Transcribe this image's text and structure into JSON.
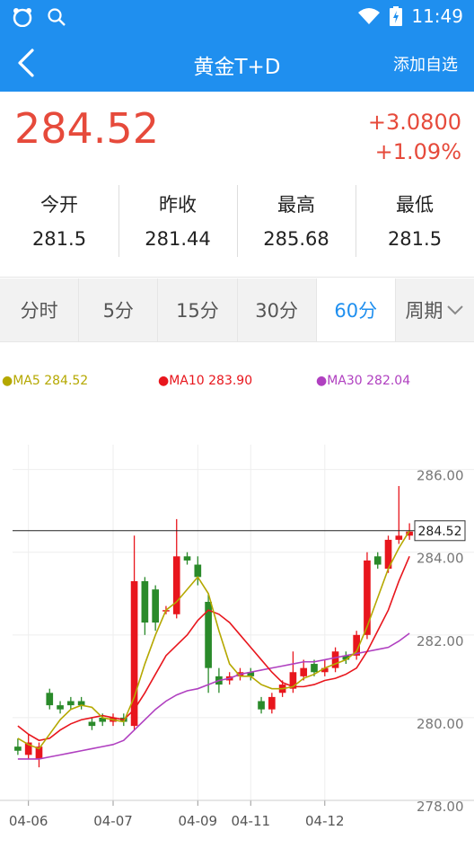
{
  "status": {
    "time": "11:49"
  },
  "header": {
    "title": "黄金T+D",
    "action": "添加自选"
  },
  "quote": {
    "price": "284.52",
    "change": "+3.0800",
    "change_pct": "+1.09%"
  },
  "stats": [
    {
      "label": "今开",
      "value": "281.5"
    },
    {
      "label": "昨收",
      "value": "281.44"
    },
    {
      "label": "最高",
      "value": "285.68"
    },
    {
      "label": "最低",
      "value": "281.5"
    }
  ],
  "tabs": [
    {
      "label": "分时"
    },
    {
      "label": "5分"
    },
    {
      "label": "15分"
    },
    {
      "label": "30分"
    },
    {
      "label": "60分"
    },
    {
      "label": "周期"
    }
  ],
  "colors": {
    "brand": "#1f8fef",
    "up": "#e8161d",
    "down": "#2a8a2a",
    "ma5": "#b5a800",
    "ma10": "#e8161d",
    "ma30": "#b040c0"
  },
  "chart_data": {
    "type": "candlestick",
    "legend": [
      {
        "name": "MA5",
        "value": "284.52"
      },
      {
        "name": "MA10",
        "value": "283.90"
      },
      {
        "name": "MA30",
        "value": "282.04"
      }
    ],
    "ylim": [
      278,
      286.6
    ],
    "yticks": [
      "286.00",
      "284.00",
      "282.00",
      "280.00",
      "278.00"
    ],
    "ytick_values": [
      286,
      284,
      282,
      280,
      278
    ],
    "last_price": 284.52,
    "last_price_label": "284.52",
    "xtick_labels": [
      "04-06",
      "04-07",
      "04-09",
      "04-11",
      "04-12"
    ],
    "xtick_index": [
      1,
      9,
      17,
      22,
      29
    ],
    "candles": [
      {
        "o": 279.3,
        "c": 279.2,
        "h": 279.5,
        "l": 279.1
      },
      {
        "o": 279.1,
        "c": 279.4,
        "h": 279.6,
        "l": 279.0
      },
      {
        "o": 279.0,
        "c": 279.3,
        "h": 279.4,
        "l": 278.8
      },
      {
        "o": 280.6,
        "c": 280.3,
        "h": 280.7,
        "l": 280.2
      },
      {
        "o": 280.3,
        "c": 280.2,
        "h": 280.4,
        "l": 280.1
      },
      {
        "o": 280.4,
        "c": 280.3,
        "h": 280.5,
        "l": 280.2
      },
      {
        "o": 280.4,
        "c": 280.3,
        "h": 280.5,
        "l": 280.2
      },
      {
        "o": 279.9,
        "c": 279.8,
        "h": 280.0,
        "l": 279.7
      },
      {
        "o": 280.0,
        "c": 279.9,
        "h": 280.1,
        "l": 279.8
      },
      {
        "o": 279.9,
        "c": 280.0,
        "h": 280.1,
        "l": 279.8
      },
      {
        "o": 280.0,
        "c": 279.9,
        "h": 280.1,
        "l": 279.8
      },
      {
        "o": 279.8,
        "c": 283.3,
        "h": 284.4,
        "l": 279.7
      },
      {
        "o": 283.3,
        "c": 282.3,
        "h": 283.4,
        "l": 282.0
      },
      {
        "o": 283.1,
        "c": 282.3,
        "h": 283.2,
        "l": 282.1
      },
      {
        "o": 282.6,
        "c": 282.6,
        "h": 282.7,
        "l": 282.5
      },
      {
        "o": 282.5,
        "c": 283.9,
        "h": 284.8,
        "l": 282.4
      },
      {
        "o": 283.9,
        "c": 283.8,
        "h": 284.0,
        "l": 283.7
      },
      {
        "o": 283.7,
        "c": 283.4,
        "h": 283.9,
        "l": 283.2
      },
      {
        "o": 282.8,
        "c": 281.2,
        "h": 283.0,
        "l": 280.6
      },
      {
        "o": 281.0,
        "c": 280.8,
        "h": 281.2,
        "l": 280.6
      },
      {
        "o": 280.9,
        "c": 281.0,
        "h": 281.1,
        "l": 280.8
      },
      {
        "o": 281.0,
        "c": 281.1,
        "h": 281.2,
        "l": 280.9
      },
      {
        "o": 281.1,
        "c": 281.0,
        "h": 281.2,
        "l": 280.9
      },
      {
        "o": 280.4,
        "c": 280.2,
        "h": 280.5,
        "l": 280.1
      },
      {
        "o": 280.2,
        "c": 280.5,
        "h": 280.6,
        "l": 280.1
      },
      {
        "o": 280.6,
        "c": 280.8,
        "h": 280.9,
        "l": 280.5
      },
      {
        "o": 280.7,
        "c": 281.1,
        "h": 281.6,
        "l": 280.6
      },
      {
        "o": 281.0,
        "c": 281.2,
        "h": 281.4,
        "l": 280.9
      },
      {
        "o": 281.3,
        "c": 281.1,
        "h": 281.4,
        "l": 281.0
      },
      {
        "o": 281.1,
        "c": 281.2,
        "h": 281.4,
        "l": 281.0
      },
      {
        "o": 281.2,
        "c": 281.6,
        "h": 281.7,
        "l": 281.1
      },
      {
        "o": 281.5,
        "c": 281.4,
        "h": 281.6,
        "l": 281.3
      },
      {
        "o": 281.5,
        "c": 282.0,
        "h": 282.1,
        "l": 281.4
      },
      {
        "o": 282.0,
        "c": 283.8,
        "h": 284.0,
        "l": 281.9
      },
      {
        "o": 283.9,
        "c": 283.7,
        "h": 284.0,
        "l": 283.6
      },
      {
        "o": 283.6,
        "c": 284.3,
        "h": 284.4,
        "l": 283.5
      },
      {
        "o": 284.3,
        "c": 284.4,
        "h": 285.6,
        "l": 284.2
      },
      {
        "o": 284.4,
        "c": 284.5,
        "h": 284.7,
        "l": 284.3
      }
    ],
    "ma5": [
      279.5,
      279.35,
      279.25,
      279.6,
      279.95,
      280.2,
      280.3,
      280.25,
      280.0,
      279.95,
      279.9,
      280.5,
      281.3,
      282.0,
      282.6,
      282.8,
      283.1,
      283.4,
      283.0,
      282.1,
      281.3,
      281.0,
      281.0,
      280.8,
      280.7,
      280.7,
      280.75,
      280.95,
      281.05,
      281.2,
      281.3,
      281.4,
      281.6,
      282.2,
      282.9,
      283.6,
      284.1,
      284.52
    ],
    "ma10": [
      279.8,
      279.6,
      279.45,
      279.5,
      279.7,
      279.85,
      279.95,
      280.0,
      280.05,
      280.0,
      279.95,
      280.2,
      280.6,
      281.05,
      281.5,
      281.75,
      282.0,
      282.35,
      282.6,
      282.5,
      282.3,
      282.0,
      281.7,
      281.4,
      281.1,
      280.85,
      280.75,
      280.75,
      280.8,
      280.9,
      280.95,
      281.05,
      281.2,
      281.6,
      282.1,
      282.6,
      283.3,
      283.9
    ],
    "ma30": [
      279.0,
      279.0,
      279.0,
      279.05,
      279.1,
      279.15,
      279.2,
      279.25,
      279.3,
      279.35,
      279.45,
      279.7,
      279.95,
      280.2,
      280.4,
      280.55,
      280.65,
      280.7,
      280.8,
      280.9,
      280.95,
      281.05,
      281.1,
      281.15,
      281.2,
      281.25,
      281.3,
      281.35,
      281.35,
      281.4,
      281.45,
      281.5,
      281.55,
      281.6,
      281.65,
      281.7,
      281.85,
      282.04
    ]
  }
}
